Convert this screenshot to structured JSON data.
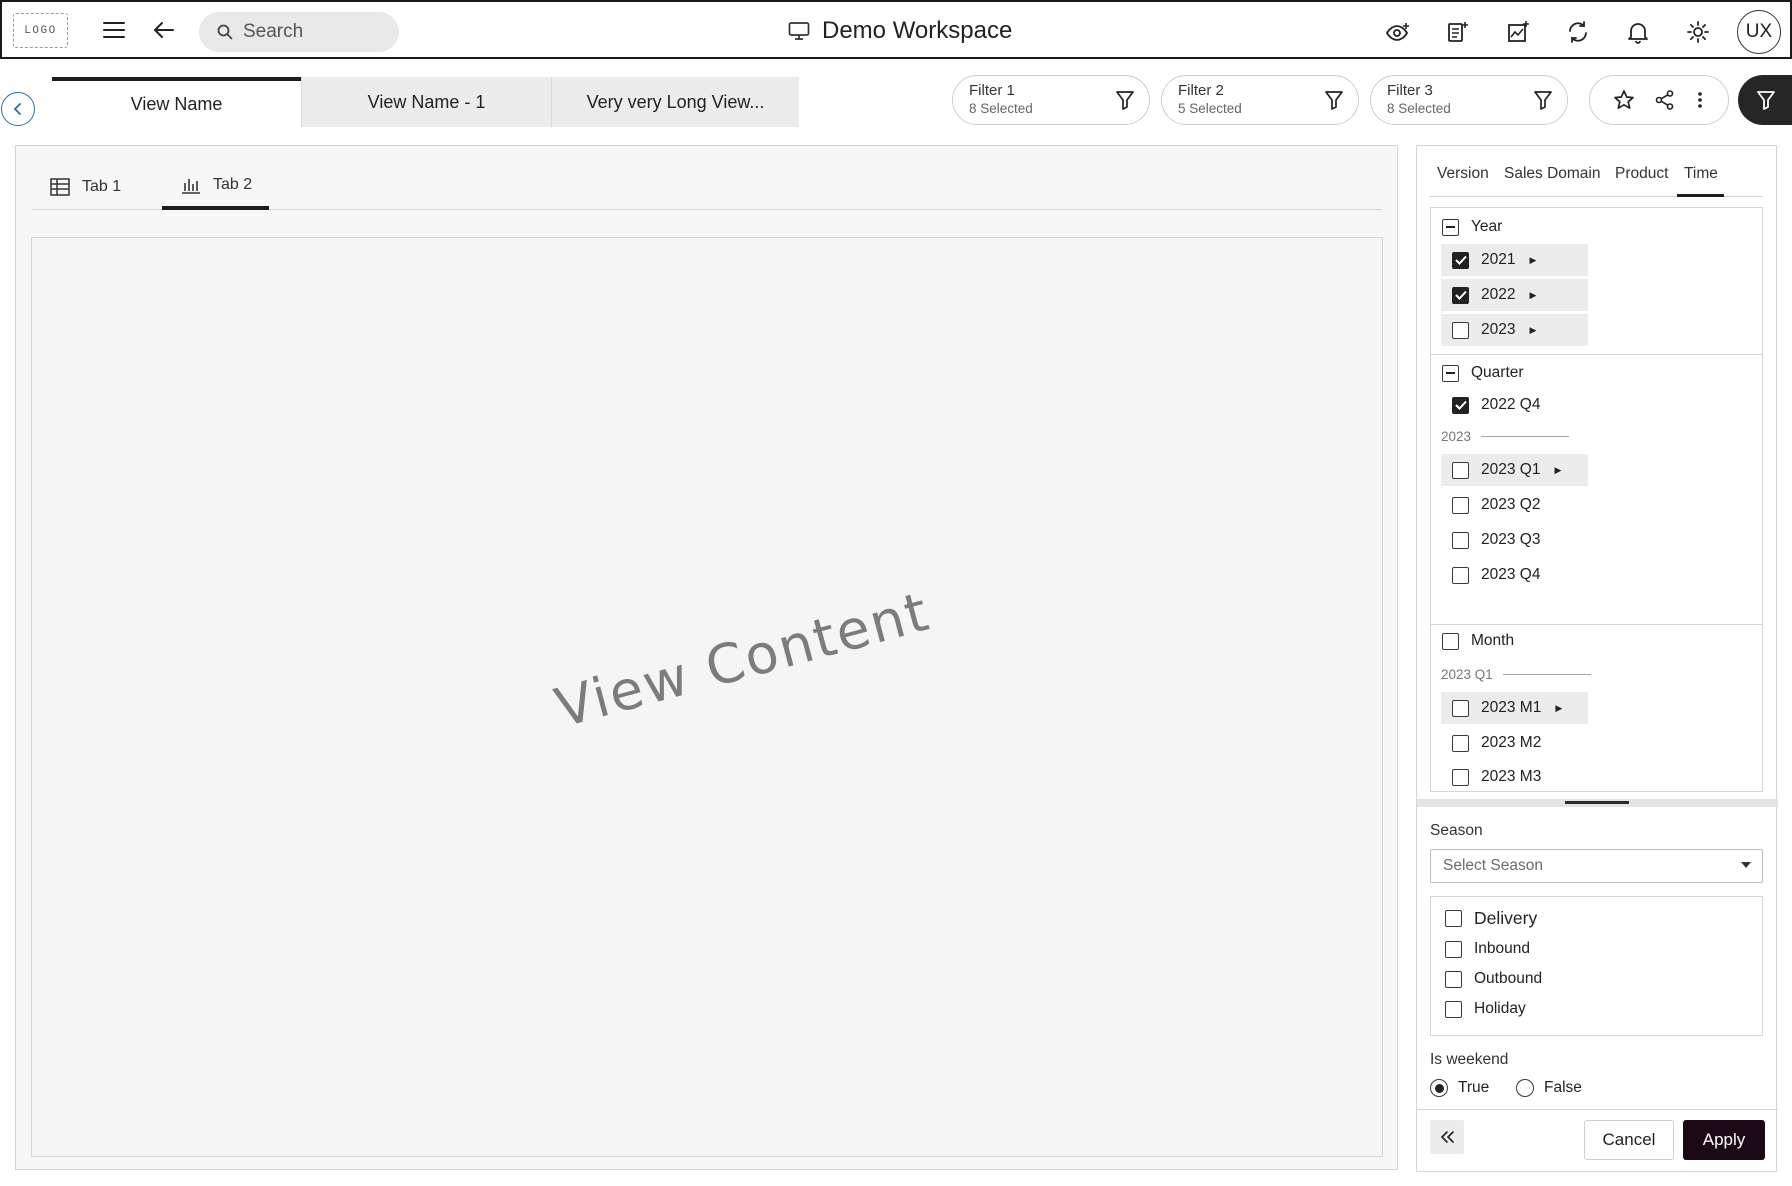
{
  "header": {
    "logo_text": "LOGO",
    "search_placeholder": "Search",
    "workspace_title": "Demo Workspace",
    "avatar_initials": "UX",
    "icons": [
      "menu-icon",
      "back-arrow-icon",
      "search-icon",
      "monitor-icon",
      "eye-plus-icon",
      "document-plus-icon",
      "chart-plus-icon",
      "refresh-icon",
      "bell-icon",
      "sun-icon"
    ]
  },
  "view_tabs": [
    {
      "label": "View Name",
      "active": true
    },
    {
      "label": "View Name - 1",
      "active": false
    },
    {
      "label": "Very very Long View...",
      "active": false
    }
  ],
  "filters": [
    {
      "name": "Filter 1",
      "selected": "8 Selected"
    },
    {
      "name": "Filter 2",
      "selected": "5 Selected"
    },
    {
      "name": "Filter 3",
      "selected": "8 Selected"
    }
  ],
  "inner_tabs": [
    {
      "label": "Tab 1",
      "icon": "table-icon",
      "active": false
    },
    {
      "label": "Tab 2",
      "icon": "bar-chart-icon",
      "active": true
    }
  ],
  "view_content_text": "View Content",
  "panel": {
    "tabs": [
      {
        "label": "Version",
        "active": false
      },
      {
        "label": "Sales Domain",
        "active": false
      },
      {
        "label": "Product",
        "active": false
      },
      {
        "label": "Time",
        "active": true
      }
    ],
    "year": {
      "heading": "Year",
      "items": [
        {
          "label": "2021",
          "checked": true
        },
        {
          "label": "2022",
          "checked": true
        },
        {
          "label": "2023",
          "checked": false
        }
      ]
    },
    "quarter": {
      "heading": "Quarter",
      "items_top": [
        {
          "label": "2022 Q4",
          "checked": true
        }
      ],
      "group_label": "2023",
      "items": [
        {
          "label": "2023 Q1",
          "checked": false
        },
        {
          "label": "2023 Q2",
          "checked": false
        },
        {
          "label": "2023 Q3",
          "checked": false
        },
        {
          "label": "2023 Q4",
          "checked": false
        }
      ]
    },
    "month": {
      "heading": "Month",
      "group_label": "2023 Q1",
      "items": [
        {
          "label": "2023 M1",
          "checked": false
        },
        {
          "label": "2023 M2",
          "checked": false
        },
        {
          "label": "2023 M3",
          "checked": false
        }
      ]
    },
    "season": {
      "label": "Season",
      "placeholder": "Select Season"
    },
    "categories": [
      {
        "label": "Delivery",
        "checked": false
      },
      {
        "label": "Inbound",
        "checked": false
      },
      {
        "label": "Outbound",
        "checked": false
      },
      {
        "label": "Holiday",
        "checked": false
      }
    ],
    "is_weekend": {
      "label": "Is weekend",
      "options": [
        {
          "label": "True",
          "selected": true
        },
        {
          "label": "False",
          "selected": false
        }
      ]
    },
    "buttons": {
      "cancel": "Cancel",
      "apply": "Apply"
    }
  },
  "colors": {
    "accent_dark": "#1b0a16",
    "back_circle": "#2e6da4",
    "highlight_row": "#ececec"
  }
}
